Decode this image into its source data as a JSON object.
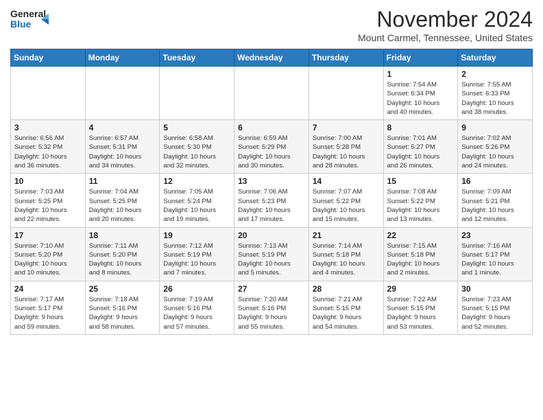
{
  "logo": {
    "line1": "General",
    "line2": "Blue",
    "icon_color": "#1a6ab5"
  },
  "title": "November 2024",
  "location": "Mount Carmel, Tennessee, United States",
  "days_of_week": [
    "Sunday",
    "Monday",
    "Tuesday",
    "Wednesday",
    "Thursday",
    "Friday",
    "Saturday"
  ],
  "weeks": [
    [
      {
        "day": "",
        "info": ""
      },
      {
        "day": "",
        "info": ""
      },
      {
        "day": "",
        "info": ""
      },
      {
        "day": "",
        "info": ""
      },
      {
        "day": "",
        "info": ""
      },
      {
        "day": "1",
        "info": "Sunrise: 7:54 AM\nSunset: 6:34 PM\nDaylight: 10 hours\nand 40 minutes."
      },
      {
        "day": "2",
        "info": "Sunrise: 7:55 AM\nSunset: 6:33 PM\nDaylight: 10 hours\nand 38 minutes."
      }
    ],
    [
      {
        "day": "3",
        "info": "Sunrise: 6:56 AM\nSunset: 5:32 PM\nDaylight: 10 hours\nand 36 minutes."
      },
      {
        "day": "4",
        "info": "Sunrise: 6:57 AM\nSunset: 5:31 PM\nDaylight: 10 hours\nand 34 minutes."
      },
      {
        "day": "5",
        "info": "Sunrise: 6:58 AM\nSunset: 5:30 PM\nDaylight: 10 hours\nand 32 minutes."
      },
      {
        "day": "6",
        "info": "Sunrise: 6:59 AM\nSunset: 5:29 PM\nDaylight: 10 hours\nand 30 minutes."
      },
      {
        "day": "7",
        "info": "Sunrise: 7:00 AM\nSunset: 5:28 PM\nDaylight: 10 hours\nand 28 minutes."
      },
      {
        "day": "8",
        "info": "Sunrise: 7:01 AM\nSunset: 5:27 PM\nDaylight: 10 hours\nand 26 minutes."
      },
      {
        "day": "9",
        "info": "Sunrise: 7:02 AM\nSunset: 5:26 PM\nDaylight: 10 hours\nand 24 minutes."
      }
    ],
    [
      {
        "day": "10",
        "info": "Sunrise: 7:03 AM\nSunset: 5:25 PM\nDaylight: 10 hours\nand 22 minutes."
      },
      {
        "day": "11",
        "info": "Sunrise: 7:04 AM\nSunset: 5:25 PM\nDaylight: 10 hours\nand 20 minutes."
      },
      {
        "day": "12",
        "info": "Sunrise: 7:05 AM\nSunset: 5:24 PM\nDaylight: 10 hours\nand 19 minutes."
      },
      {
        "day": "13",
        "info": "Sunrise: 7:06 AM\nSunset: 5:23 PM\nDaylight: 10 hours\nand 17 minutes."
      },
      {
        "day": "14",
        "info": "Sunrise: 7:07 AM\nSunset: 5:22 PM\nDaylight: 10 hours\nand 15 minutes."
      },
      {
        "day": "15",
        "info": "Sunrise: 7:08 AM\nSunset: 5:22 PM\nDaylight: 10 hours\nand 13 minutes."
      },
      {
        "day": "16",
        "info": "Sunrise: 7:09 AM\nSunset: 5:21 PM\nDaylight: 10 hours\nand 12 minutes."
      }
    ],
    [
      {
        "day": "17",
        "info": "Sunrise: 7:10 AM\nSunset: 5:20 PM\nDaylight: 10 hours\nand 10 minutes."
      },
      {
        "day": "18",
        "info": "Sunrise: 7:11 AM\nSunset: 5:20 PM\nDaylight: 10 hours\nand 8 minutes."
      },
      {
        "day": "19",
        "info": "Sunrise: 7:12 AM\nSunset: 5:19 PM\nDaylight: 10 hours\nand 7 minutes."
      },
      {
        "day": "20",
        "info": "Sunrise: 7:13 AM\nSunset: 5:19 PM\nDaylight: 10 hours\nand 5 minutes."
      },
      {
        "day": "21",
        "info": "Sunrise: 7:14 AM\nSunset: 5:18 PM\nDaylight: 10 hours\nand 4 minutes."
      },
      {
        "day": "22",
        "info": "Sunrise: 7:15 AM\nSunset: 5:18 PM\nDaylight: 10 hours\nand 2 minutes."
      },
      {
        "day": "23",
        "info": "Sunrise: 7:16 AM\nSunset: 5:17 PM\nDaylight: 10 hours\nand 1 minute."
      }
    ],
    [
      {
        "day": "24",
        "info": "Sunrise: 7:17 AM\nSunset: 5:17 PM\nDaylight: 9 hours\nand 59 minutes."
      },
      {
        "day": "25",
        "info": "Sunrise: 7:18 AM\nSunset: 5:16 PM\nDaylight: 9 hours\nand 58 minutes."
      },
      {
        "day": "26",
        "info": "Sunrise: 7:19 AM\nSunset: 5:16 PM\nDaylight: 9 hours\nand 57 minutes."
      },
      {
        "day": "27",
        "info": "Sunrise: 7:20 AM\nSunset: 5:16 PM\nDaylight: 9 hours\nand 55 minutes."
      },
      {
        "day": "28",
        "info": "Sunrise: 7:21 AM\nSunset: 5:15 PM\nDaylight: 9 hours\nand 54 minutes."
      },
      {
        "day": "29",
        "info": "Sunrise: 7:22 AM\nSunset: 5:15 PM\nDaylight: 9 hours\nand 53 minutes."
      },
      {
        "day": "30",
        "info": "Sunrise: 7:23 AM\nSunset: 5:15 PM\nDaylight: 9 hours\nand 52 minutes."
      }
    ]
  ]
}
